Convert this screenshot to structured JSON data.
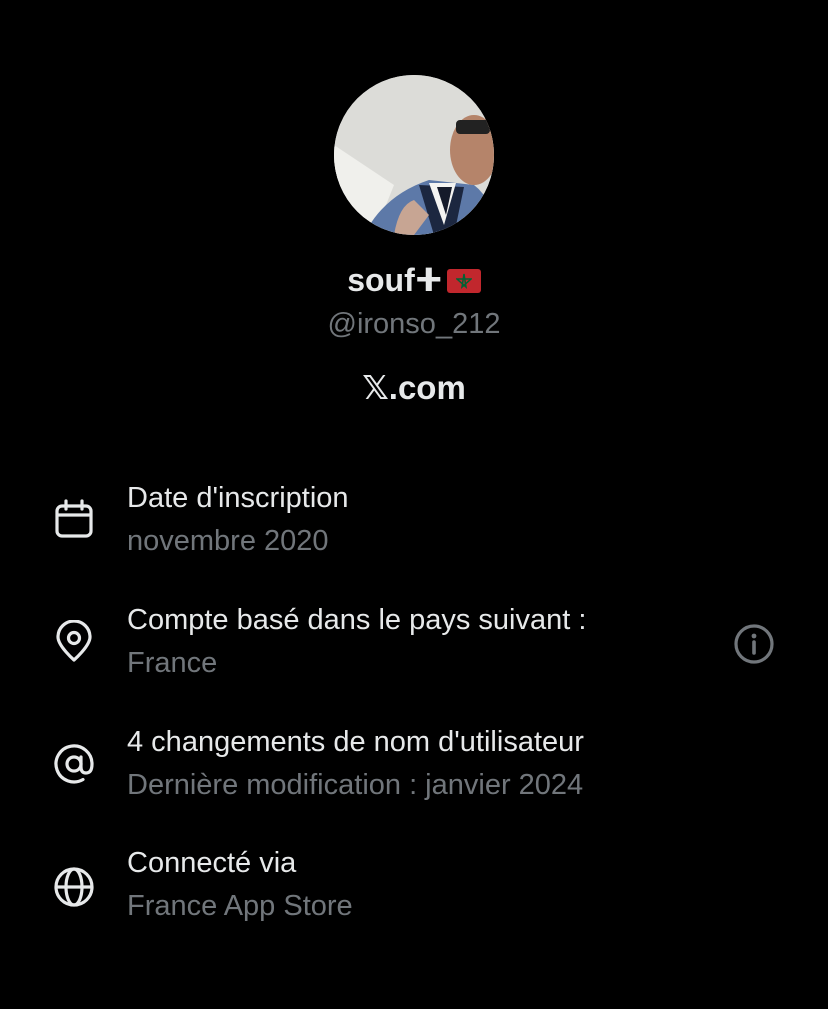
{
  "profile": {
    "display_name": "soufⵜ",
    "flag_icon": "morocco-flag-icon",
    "handle": "@ironso_212",
    "source_site": "𝕏.com"
  },
  "about_items": [
    {
      "icon": "calendar-icon",
      "title": "Date d'inscription",
      "value": "novembre 2020"
    },
    {
      "icon": "location-pin-icon",
      "title": "Compte basé dans le pays suivant :",
      "value": "France",
      "action_icon": "info-icon"
    },
    {
      "icon": "at-sign-icon",
      "title": "4 changements de nom d'utilisateur",
      "value": "Dernière modification : janvier 2024"
    },
    {
      "icon": "globe-icon",
      "title": "Connecté via",
      "value": "France App Store"
    }
  ],
  "colors": {
    "background": "#000000",
    "primary_text": "#e7e9ea",
    "secondary_text": "#71767b",
    "flag_red": "#c1272d",
    "flag_green": "#006233"
  }
}
